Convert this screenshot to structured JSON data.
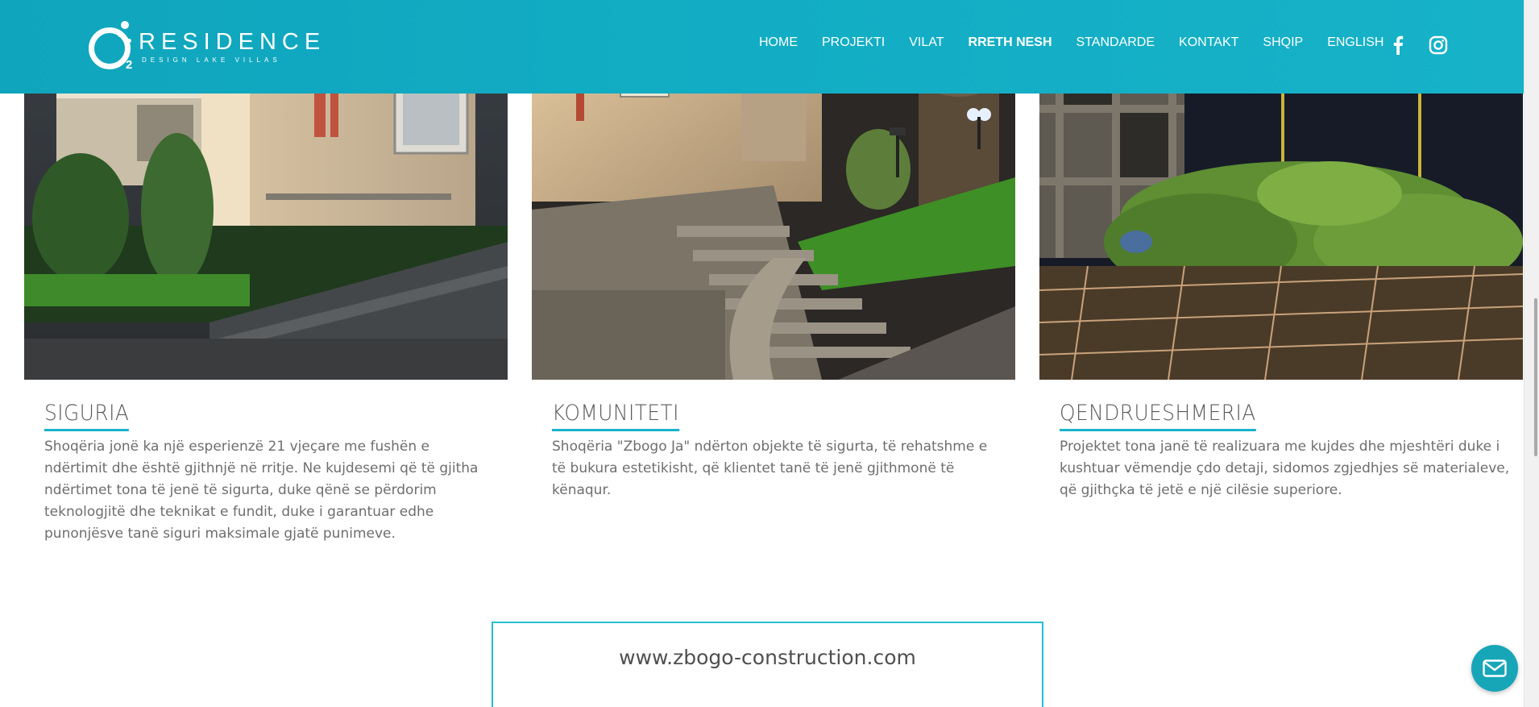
{
  "header": {
    "logo": {
      "wordmark": "RESIDENCE",
      "tagline": "DESIGN LAKE VILLAS",
      "o2_subscript": "2"
    },
    "nav": [
      {
        "label": "HOME",
        "active": false
      },
      {
        "label": "PROJEKTI",
        "active": false
      },
      {
        "label": "VILAT",
        "active": false
      },
      {
        "label": "RRETH NESH",
        "active": true
      },
      {
        "label": "STANDARDE",
        "active": false
      },
      {
        "label": "KONTAKT",
        "active": false
      },
      {
        "label": "SHQIP",
        "active": false
      },
      {
        "label": "ENGLISH",
        "active": false
      }
    ],
    "social": [
      "facebook-icon",
      "instagram-icon"
    ]
  },
  "cards": [
    {
      "title": "SIGURIA",
      "text": "Shoqëria jonë ka një esperienzë 21 vjeçare me fushën e ndërtimit dhe është gjithnjë në rritje. Ne kujdesemi që të gjitha ndërtimet tona të jenë të sigurta, duke qënë se përdorim teknologjitë dhe teknikat e fundit, duke i garantuar edhe punonjësve tanë siguri maksimale gjatë punimeve."
    },
    {
      "title": "KOMUNITETI",
      "text": "Shoqëria \"Zbogo Ja\" ndërton objekte të sigurta, të rehatshme e të bukura estetikisht, që klientet tanë të jenë gjithmonë të kënaqur."
    },
    {
      "title": "QENDRUESHMERIA",
      "text": "Projektet tona janë të realizuara me kujdes dhe mjeshtëri duke i kushtuar vëmendje çdo detaji, sidomos zgjedhjes së materialeve, që gjithçka të jetë e një cilësie superiore."
    }
  ],
  "footer_box": {
    "url": "www.zbogo-construction.com"
  },
  "colors": {
    "header_teal": "#12adc4",
    "accent": "#18b3c9",
    "chat_button": "#17a6b8"
  },
  "chat": {
    "icon": "mail-icon"
  }
}
